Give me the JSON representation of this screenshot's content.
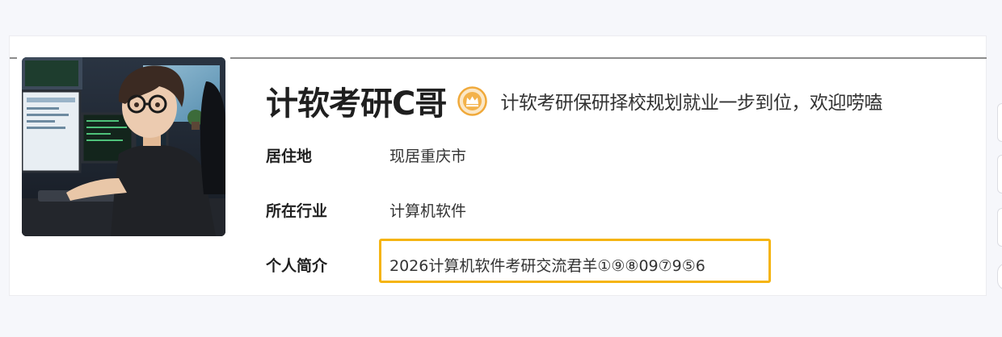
{
  "profile": {
    "name": "计软考研C哥",
    "tagline": "计软考研保研择校规划就业一步到位，欢迎唠嗑",
    "badge_icon": "crown-badge-icon",
    "badge_color": "#f0a93a",
    "fields": [
      {
        "label": "居住地",
        "value": "现居重庆市"
      },
      {
        "label": "所在行业",
        "value": "计算机软件"
      },
      {
        "label": "个人简介",
        "value": "2026计算机软件考研交流君羊①⑨⑧09⑦9⑤6"
      }
    ],
    "highlight_color": "#f5b40f"
  }
}
